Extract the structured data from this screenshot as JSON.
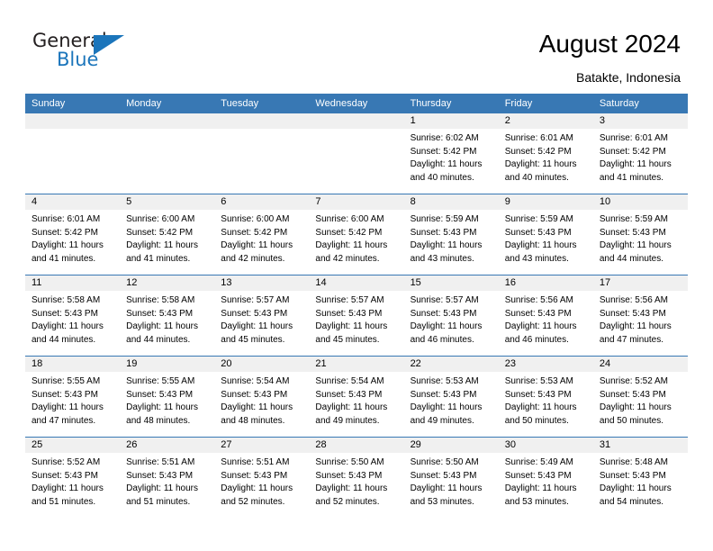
{
  "brand": {
    "name_top": "General",
    "name_bottom": "Blue",
    "triangle_color": "#1b75bb",
    "text_color": "#231f20"
  },
  "header": {
    "title": "August 2024",
    "location": "Batakte, Indonesia"
  },
  "theme": {
    "header_blue": "#3878b4",
    "daynum_band": "#f0f0f0",
    "text": "#000000"
  },
  "weekday_headers": [
    "Sunday",
    "Monday",
    "Tuesday",
    "Wednesday",
    "Thursday",
    "Friday",
    "Saturday"
  ],
  "weeks": [
    [
      {
        "day": "",
        "sunrise": "",
        "sunset": "",
        "daylight_1": "",
        "daylight_2": ""
      },
      {
        "day": "",
        "sunrise": "",
        "sunset": "",
        "daylight_1": "",
        "daylight_2": ""
      },
      {
        "day": "",
        "sunrise": "",
        "sunset": "",
        "daylight_1": "",
        "daylight_2": ""
      },
      {
        "day": "",
        "sunrise": "",
        "sunset": "",
        "daylight_1": "",
        "daylight_2": ""
      },
      {
        "day": "1",
        "sunrise": "Sunrise: 6:02 AM",
        "sunset": "Sunset: 5:42 PM",
        "daylight_1": "Daylight: 11 hours",
        "daylight_2": "and 40 minutes."
      },
      {
        "day": "2",
        "sunrise": "Sunrise: 6:01 AM",
        "sunset": "Sunset: 5:42 PM",
        "daylight_1": "Daylight: 11 hours",
        "daylight_2": "and 40 minutes."
      },
      {
        "day": "3",
        "sunrise": "Sunrise: 6:01 AM",
        "sunset": "Sunset: 5:42 PM",
        "daylight_1": "Daylight: 11 hours",
        "daylight_2": "and 41 minutes."
      }
    ],
    [
      {
        "day": "4",
        "sunrise": "Sunrise: 6:01 AM",
        "sunset": "Sunset: 5:42 PM",
        "daylight_1": "Daylight: 11 hours",
        "daylight_2": "and 41 minutes."
      },
      {
        "day": "5",
        "sunrise": "Sunrise: 6:00 AM",
        "sunset": "Sunset: 5:42 PM",
        "daylight_1": "Daylight: 11 hours",
        "daylight_2": "and 41 minutes."
      },
      {
        "day": "6",
        "sunrise": "Sunrise: 6:00 AM",
        "sunset": "Sunset: 5:42 PM",
        "daylight_1": "Daylight: 11 hours",
        "daylight_2": "and 42 minutes."
      },
      {
        "day": "7",
        "sunrise": "Sunrise: 6:00 AM",
        "sunset": "Sunset: 5:42 PM",
        "daylight_1": "Daylight: 11 hours",
        "daylight_2": "and 42 minutes."
      },
      {
        "day": "8",
        "sunrise": "Sunrise: 5:59 AM",
        "sunset": "Sunset: 5:43 PM",
        "daylight_1": "Daylight: 11 hours",
        "daylight_2": "and 43 minutes."
      },
      {
        "day": "9",
        "sunrise": "Sunrise: 5:59 AM",
        "sunset": "Sunset: 5:43 PM",
        "daylight_1": "Daylight: 11 hours",
        "daylight_2": "and 43 minutes."
      },
      {
        "day": "10",
        "sunrise": "Sunrise: 5:59 AM",
        "sunset": "Sunset: 5:43 PM",
        "daylight_1": "Daylight: 11 hours",
        "daylight_2": "and 44 minutes."
      }
    ],
    [
      {
        "day": "11",
        "sunrise": "Sunrise: 5:58 AM",
        "sunset": "Sunset: 5:43 PM",
        "daylight_1": "Daylight: 11 hours",
        "daylight_2": "and 44 minutes."
      },
      {
        "day": "12",
        "sunrise": "Sunrise: 5:58 AM",
        "sunset": "Sunset: 5:43 PM",
        "daylight_1": "Daylight: 11 hours",
        "daylight_2": "and 44 minutes."
      },
      {
        "day": "13",
        "sunrise": "Sunrise: 5:57 AM",
        "sunset": "Sunset: 5:43 PM",
        "daylight_1": "Daylight: 11 hours",
        "daylight_2": "and 45 minutes."
      },
      {
        "day": "14",
        "sunrise": "Sunrise: 5:57 AM",
        "sunset": "Sunset: 5:43 PM",
        "daylight_1": "Daylight: 11 hours",
        "daylight_2": "and 45 minutes."
      },
      {
        "day": "15",
        "sunrise": "Sunrise: 5:57 AM",
        "sunset": "Sunset: 5:43 PM",
        "daylight_1": "Daylight: 11 hours",
        "daylight_2": "and 46 minutes."
      },
      {
        "day": "16",
        "sunrise": "Sunrise: 5:56 AM",
        "sunset": "Sunset: 5:43 PM",
        "daylight_1": "Daylight: 11 hours",
        "daylight_2": "and 46 minutes."
      },
      {
        "day": "17",
        "sunrise": "Sunrise: 5:56 AM",
        "sunset": "Sunset: 5:43 PM",
        "daylight_1": "Daylight: 11 hours",
        "daylight_2": "and 47 minutes."
      }
    ],
    [
      {
        "day": "18",
        "sunrise": "Sunrise: 5:55 AM",
        "sunset": "Sunset: 5:43 PM",
        "daylight_1": "Daylight: 11 hours",
        "daylight_2": "and 47 minutes."
      },
      {
        "day": "19",
        "sunrise": "Sunrise: 5:55 AM",
        "sunset": "Sunset: 5:43 PM",
        "daylight_1": "Daylight: 11 hours",
        "daylight_2": "and 48 minutes."
      },
      {
        "day": "20",
        "sunrise": "Sunrise: 5:54 AM",
        "sunset": "Sunset: 5:43 PM",
        "daylight_1": "Daylight: 11 hours",
        "daylight_2": "and 48 minutes."
      },
      {
        "day": "21",
        "sunrise": "Sunrise: 5:54 AM",
        "sunset": "Sunset: 5:43 PM",
        "daylight_1": "Daylight: 11 hours",
        "daylight_2": "and 49 minutes."
      },
      {
        "day": "22",
        "sunrise": "Sunrise: 5:53 AM",
        "sunset": "Sunset: 5:43 PM",
        "daylight_1": "Daylight: 11 hours",
        "daylight_2": "and 49 minutes."
      },
      {
        "day": "23",
        "sunrise": "Sunrise: 5:53 AM",
        "sunset": "Sunset: 5:43 PM",
        "daylight_1": "Daylight: 11 hours",
        "daylight_2": "and 50 minutes."
      },
      {
        "day": "24",
        "sunrise": "Sunrise: 5:52 AM",
        "sunset": "Sunset: 5:43 PM",
        "daylight_1": "Daylight: 11 hours",
        "daylight_2": "and 50 minutes."
      }
    ],
    [
      {
        "day": "25",
        "sunrise": "Sunrise: 5:52 AM",
        "sunset": "Sunset: 5:43 PM",
        "daylight_1": "Daylight: 11 hours",
        "daylight_2": "and 51 minutes."
      },
      {
        "day": "26",
        "sunrise": "Sunrise: 5:51 AM",
        "sunset": "Sunset: 5:43 PM",
        "daylight_1": "Daylight: 11 hours",
        "daylight_2": "and 51 minutes."
      },
      {
        "day": "27",
        "sunrise": "Sunrise: 5:51 AM",
        "sunset": "Sunset: 5:43 PM",
        "daylight_1": "Daylight: 11 hours",
        "daylight_2": "and 52 minutes."
      },
      {
        "day": "28",
        "sunrise": "Sunrise: 5:50 AM",
        "sunset": "Sunset: 5:43 PM",
        "daylight_1": "Daylight: 11 hours",
        "daylight_2": "and 52 minutes."
      },
      {
        "day": "29",
        "sunrise": "Sunrise: 5:50 AM",
        "sunset": "Sunset: 5:43 PM",
        "daylight_1": "Daylight: 11 hours",
        "daylight_2": "and 53 minutes."
      },
      {
        "day": "30",
        "sunrise": "Sunrise: 5:49 AM",
        "sunset": "Sunset: 5:43 PM",
        "daylight_1": "Daylight: 11 hours",
        "daylight_2": "and 53 minutes."
      },
      {
        "day": "31",
        "sunrise": "Sunrise: 5:48 AM",
        "sunset": "Sunset: 5:43 PM",
        "daylight_1": "Daylight: 11 hours",
        "daylight_2": "and 54 minutes."
      }
    ]
  ]
}
